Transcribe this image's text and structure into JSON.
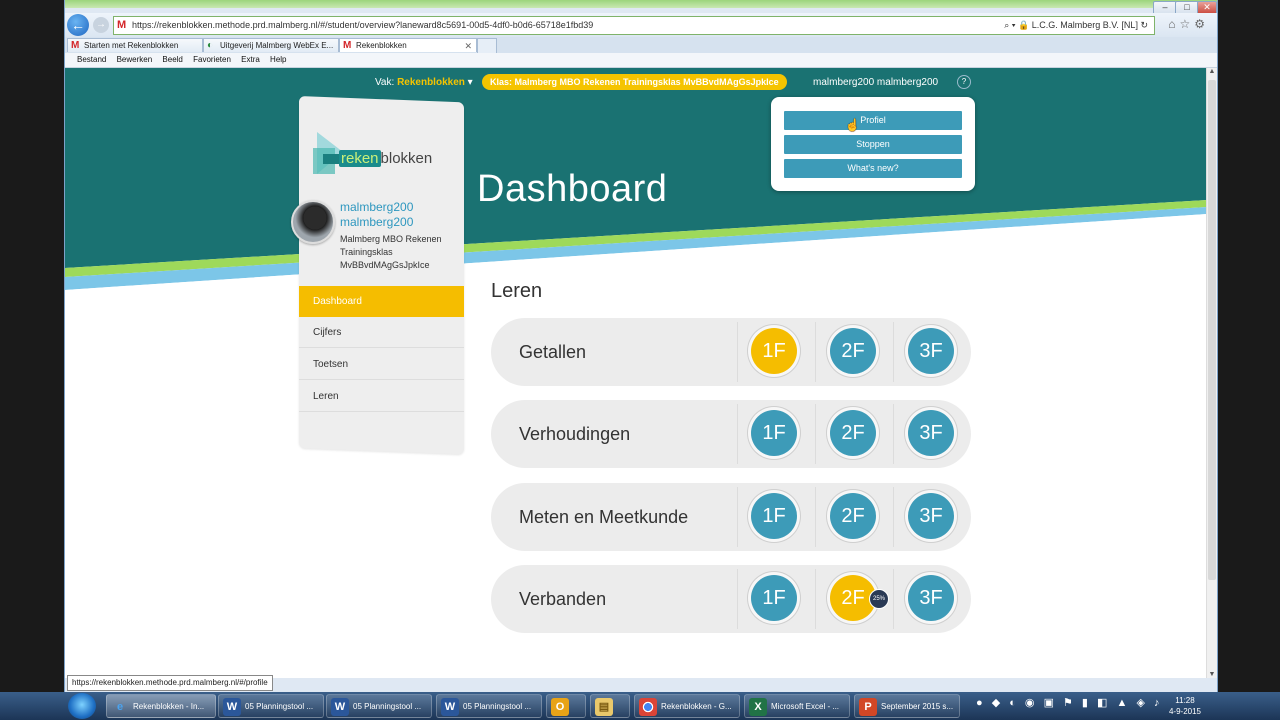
{
  "browser": {
    "url": "https://rekenblokken.methode.prd.malmberg.nl/#/student/overview?laneward8c5691-00d5-4df0-b0d6-65718e1fbd39",
    "site_identity": "L.C.G. Malmberg B.V. [NL]",
    "tabs": [
      {
        "label": "Starten met Rekenblokken"
      },
      {
        "label": "Uitgeverij Malmberg WebEx E..."
      },
      {
        "label": "Rekenblokken"
      }
    ],
    "menu": [
      "Bestand",
      "Bewerken",
      "Beeld",
      "Favorieten",
      "Extra",
      "Help"
    ],
    "status_url": "https://rekenblokken.methode.prd.malmberg.nl/#/profile"
  },
  "topbar": {
    "vak_label": "Vak:",
    "vak_value": "Rekenblokken",
    "klas_label": "Klas:",
    "klas_value": "Malmberg MBO Rekenen Trainingsklas MvBBvdMAgGsJpkIce",
    "username": "malmberg200 malmberg200",
    "help": "?"
  },
  "dropdown": {
    "items": [
      "Profiel",
      "Stoppen",
      "What's new?"
    ]
  },
  "page_title": "Dashboard",
  "sidebar": {
    "logo_part1": "reken",
    "logo_part2": "blokken",
    "user_first": "malmberg200",
    "user_last": "malmberg200",
    "class_name": "Malmberg MBO Rekenen Trainingsklas MvBBvdMAgGsJpkIce",
    "nav": [
      {
        "label": "Dashboard",
        "active": true
      },
      {
        "label": "Cijfers"
      },
      {
        "label": "Toetsen"
      },
      {
        "label": "Leren"
      }
    ]
  },
  "leren": {
    "heading": "Leren",
    "domains": [
      {
        "label": "Getallen",
        "levels": [
          "1F",
          "2F",
          "3F"
        ],
        "highlight": 0
      },
      {
        "label": "Verhoudingen",
        "levels": [
          "1F",
          "2F",
          "3F"
        ],
        "highlight": -1
      },
      {
        "label": "Meten en Meetkunde",
        "levels": [
          "1F",
          "2F",
          "3F"
        ],
        "highlight": -1
      },
      {
        "label": "Verbanden",
        "levels": [
          "1F",
          "2F",
          "3F"
        ],
        "highlight": 1,
        "badge": "25%"
      }
    ]
  },
  "taskbar": {
    "items": [
      {
        "label": "Rekenblokken - In..."
      },
      {
        "label": "05 Planningstool ..."
      },
      {
        "label": "05 Planningstool ..."
      },
      {
        "label": "05 Planningstool ..."
      },
      {
        "label": ""
      },
      {
        "label": ""
      },
      {
        "label": "Rekenblokken - G..."
      },
      {
        "label": "Microsoft Excel - ..."
      },
      {
        "label": "September 2015 s..."
      }
    ],
    "time": "11:28",
    "date": "4-9-2015"
  },
  "colors": {
    "teal": "#1a7272",
    "yellow": "#f5bd00",
    "blue": "#3d9bb8"
  }
}
